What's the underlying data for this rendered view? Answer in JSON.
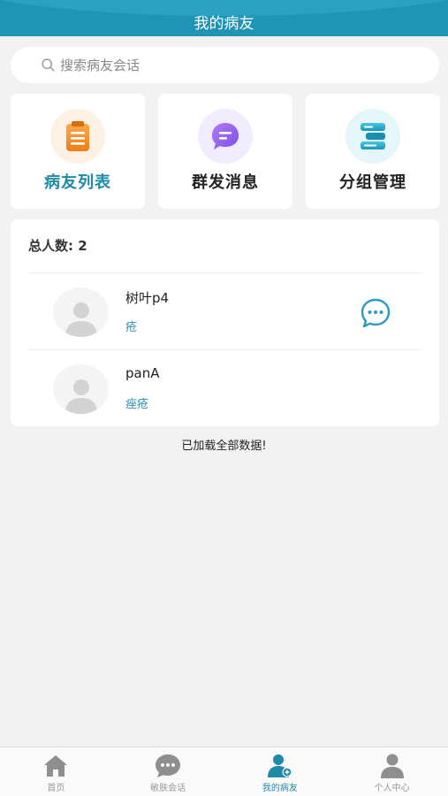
{
  "header": {
    "title": "我的病友"
  },
  "search": {
    "placeholder": "搜索病友会话"
  },
  "quick_cards": [
    {
      "label": "病友列表",
      "icon": "clipboard-icon",
      "color": "#f08a1c",
      "active": true
    },
    {
      "label": "群发消息",
      "icon": "message-bubble-icon",
      "color": "#8a5cf0",
      "active": false
    },
    {
      "label": "分组管理",
      "icon": "group-list-icon",
      "color": "#1ea9c8",
      "active": false
    }
  ],
  "patients": {
    "total_label": "总人数: 2",
    "items": [
      {
        "name": "树叶p4",
        "tag": "疮",
        "has_chat": true
      },
      {
        "name": "panA",
        "tag": "痤疮",
        "has_chat": false
      }
    ]
  },
  "status": {
    "loaded_text": "已加载全部数据!"
  },
  "tabbar": {
    "items": [
      {
        "label": "首页",
        "icon": "home-icon",
        "active": false
      },
      {
        "label": "敏肤会话",
        "icon": "chat-icon",
        "active": false
      },
      {
        "label": "我的病友",
        "icon": "patient-add-icon",
        "active": true
      },
      {
        "label": "个人中心",
        "icon": "person-icon",
        "active": false
      }
    ]
  },
  "colors": {
    "primary": "#1f94b4",
    "accent": "#2f91b5",
    "tab_active": "#1f8aa8",
    "tab_inactive": "#999999"
  }
}
